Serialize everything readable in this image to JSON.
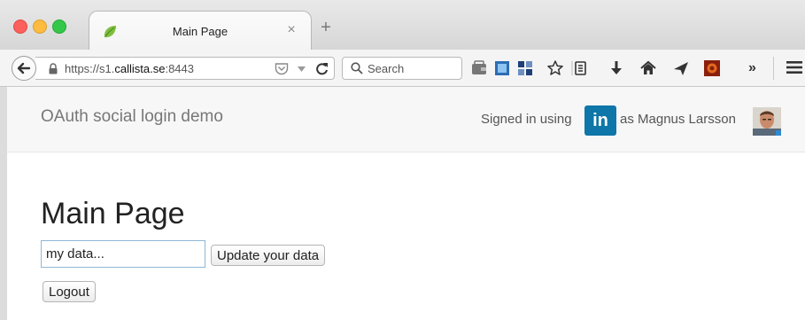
{
  "browser": {
    "tab": {
      "title": "Main Page",
      "close_glyph": "×",
      "favicon": "spring-leaf-icon"
    },
    "new_tab_glyph": "+",
    "address": {
      "protocol": "https://",
      "host_prefix": "s1.",
      "host_domain": "callista.se",
      "port": ":8443"
    },
    "search": {
      "placeholder": "Search"
    },
    "overflow_glyph": "»",
    "icons": [
      "back-arrow-icon",
      "lock-icon",
      "pocket-icon",
      "reload-icon",
      "search-icon",
      "wallet-icon",
      "screenshot-icon",
      "tiles-icon",
      "star-icon",
      "reading-list-icon",
      "download-icon",
      "home-icon",
      "send-icon",
      "addon-icon",
      "menu-icon"
    ],
    "colors": {
      "close": "#fc605c",
      "minimize": "#fdbc40",
      "maximize": "#34c84a"
    }
  },
  "site": {
    "brand": "OAuth social login demo",
    "signin": {
      "prefix": "Signed in using",
      "provider_logo_text": "in",
      "suffix": "as Magnus Larsson",
      "provider_color": "#0e76a8"
    }
  },
  "main": {
    "title": "Main Page",
    "data_input_value": "my data...",
    "update_button": "Update your data",
    "logout_button": "Logout"
  }
}
